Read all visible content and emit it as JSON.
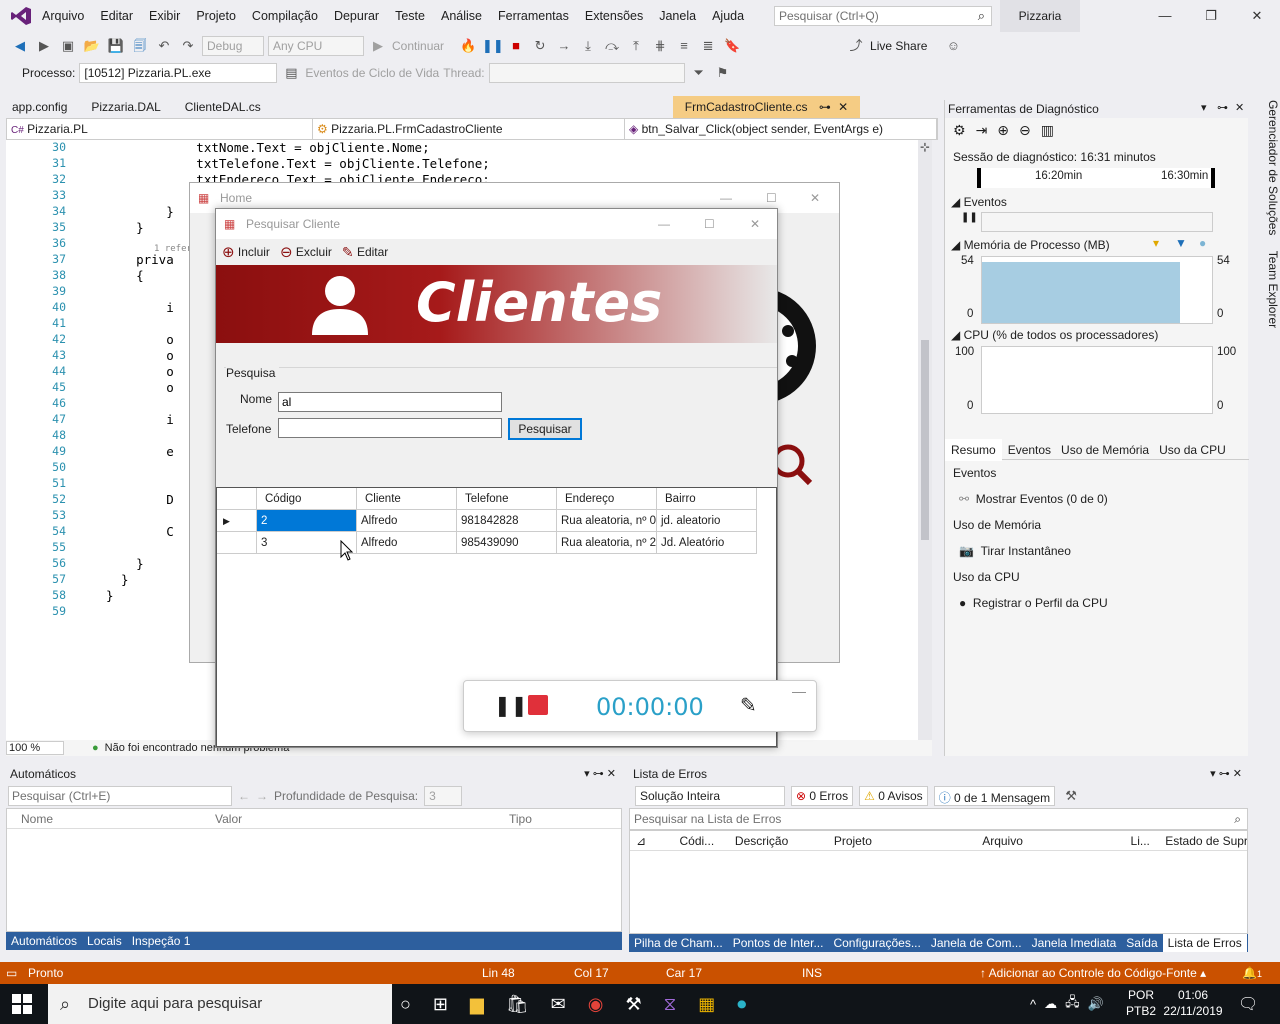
{
  "menubar": {
    "items": [
      "Arquivo",
      "Editar",
      "Exibir",
      "Projeto",
      "Compilação",
      "Depurar",
      "Teste",
      "Análise",
      "Ferramentas",
      "Extensões",
      "Janela",
      "Ajuda"
    ],
    "search_placeholder": "Pesquisar (Ctrl+Q)",
    "solution": "Pizzaria"
  },
  "toolbar1": {
    "config": "Debug",
    "platform": "Any CPU",
    "continue_label": "Continuar",
    "live_share": "Live Share"
  },
  "toolbar2": {
    "process_label": "Processo:",
    "process_value": "[10512] Pizzaria.PL.exe",
    "lifecycle_label": "Eventos de Ciclo de Vida",
    "thread_label": "Thread:"
  },
  "editor": {
    "tabs": [
      "app.config",
      "Pizzaria.DAL",
      "ClienteDAL.cs",
      "FrmCadastroCliente.cs"
    ],
    "nav": [
      "Pizzaria.PL",
      "Pizzaria.PL.FrmCadastroCliente",
      "btn_Salvar_Click(object sender, EventArgs e)"
    ],
    "lines": [
      {
        "n": "30",
        "code": "            txtNome.Text = objCliente.Nome;"
      },
      {
        "n": "31",
        "code": "            txtTelefone.Text = objCliente.Telefone;"
      },
      {
        "n": "32",
        "code": "            txtEndereco.Text = objCliente.Endereco;"
      },
      {
        "n": "33",
        "code": ""
      },
      {
        "n": "34",
        "code": "        }"
      },
      {
        "n": "35",
        "code": "    }"
      },
      {
        "n": "36",
        "code": ""
      },
      {
        "n": "37",
        "code": "    priva"
      },
      {
        "n": "38",
        "code": "    {"
      },
      {
        "n": "39",
        "code": ""
      },
      {
        "n": "40",
        "code": "        i"
      },
      {
        "n": "41",
        "code": ""
      },
      {
        "n": "42",
        "code": "        o"
      },
      {
        "n": "43",
        "code": "        o"
      },
      {
        "n": "44",
        "code": "        o"
      },
      {
        "n": "45",
        "code": "        o"
      },
      {
        "n": "46",
        "code": ""
      },
      {
        "n": "47",
        "code": "        i"
      },
      {
        "n": "48",
        "code": ""
      },
      {
        "n": "49",
        "code": "        e"
      },
      {
        "n": "50",
        "code": ""
      },
      {
        "n": "51",
        "code": ""
      },
      {
        "n": "52",
        "code": "        D"
      },
      {
        "n": "53",
        "code": ""
      },
      {
        "n": "54",
        "code": "        C"
      },
      {
        "n": "55",
        "code": ""
      },
      {
        "n": "56",
        "code": "    }"
      },
      {
        "n": "57",
        "code": "  }"
      },
      {
        "n": "58",
        "code": "}"
      },
      {
        "n": "59",
        "code": ""
      }
    ],
    "ref_hint": "1 referê",
    "zoom": "100 %",
    "status_msg": "Não foi encontrado nenhum problema"
  },
  "diag": {
    "title": "Ferramentas de Diagnóstico",
    "session": "Sessão de diagnóstico: 16:31 minutos",
    "t1": "16:20min",
    "t2": "16:30min",
    "events_label": "Eventos",
    "mem_label": "Memória de Processo (MB)",
    "mem_max": "54",
    "mem_min": "0",
    "cpu_label": "CPU (% de todos os processadores)",
    "cpu_max": "100",
    "cpu_min": "0",
    "tabs": [
      "Resumo",
      "Eventos",
      "Uso de Memória",
      "Uso da CPU"
    ],
    "sec_events": "Eventos",
    "show_events": "Mostrar Eventos (0 de 0)",
    "sec_mem": "Uso de Memória",
    "snapshot": "Tirar Instantâneo",
    "sec_cpu": "Uso da CPU",
    "cpu_profile": "Registrar o Perfil da CPU",
    "mem_fill": 0.92
  },
  "side_tabs": [
    "Gerenciador de Soluções",
    "Team Explorer"
  ],
  "autos": {
    "title": "Automáticos",
    "search": "Pesquisar (Ctrl+E)",
    "depth_label": "Profundidade de Pesquisa:",
    "depth_value": "3",
    "cols": [
      "Nome",
      "Valor",
      "Tipo"
    ],
    "tabs": [
      "Automáticos",
      "Locais",
      "Inspeção 1"
    ]
  },
  "errors": {
    "title": "Lista de Erros",
    "scope": "Solução Inteira",
    "errors_btn": "0 Erros",
    "warnings_btn": "0 Avisos",
    "messages_btn": "0 de 1 Mensagem",
    "search": "Pesquisar na Lista de Erros",
    "cols": [
      "Códi...",
      "Descrição",
      "Projeto",
      "Arquivo",
      "Li...",
      "Estado de Supr"
    ],
    "tabs": [
      "Pilha de Cham...",
      "Pontos de Inter...",
      "Configurações...",
      "Janela de Com...",
      "Janela Imediata",
      "Saída",
      "Lista de Erros"
    ]
  },
  "status": {
    "ready": "Pronto",
    "line": "Lin 48",
    "col": "Col 17",
    "car": "Car 17",
    "ins": "INS",
    "source_control": "Adicionar ao Controle do Código-Fonte",
    "notifications": "1"
  },
  "taskbar": {
    "search": "Digite aqui para pesquisar",
    "lang1": "POR",
    "lang2": "PTB2",
    "time": "01:06",
    "date": "22/11/2019"
  },
  "home_window": {
    "title": "Home"
  },
  "pesquisar": {
    "title": "Pesquisar Cliente",
    "btn_incluir": "Incluir",
    "btn_excluir": "Excluir",
    "btn_editar": "Editar",
    "banner": "Clientes",
    "group": "Pesquisa",
    "nome_label": "Nome",
    "nome_value": "al",
    "telefone_label": "Telefone",
    "telefone_value": "",
    "search_btn": "Pesquisar",
    "grid_cols": [
      "Código",
      "Cliente",
      "Telefone",
      "Endereço",
      "Bairro"
    ],
    "grid_rows": [
      [
        "2",
        "Alfredo",
        "981842828",
        "Rua aleatoria, nº 0",
        "jd. aleatorio"
      ],
      [
        "3",
        "Alfredo",
        "985439090",
        "Rua aleatoria, nº 2",
        "Jd. Aleatório"
      ]
    ]
  },
  "recorder": {
    "time": "00:00:00"
  }
}
